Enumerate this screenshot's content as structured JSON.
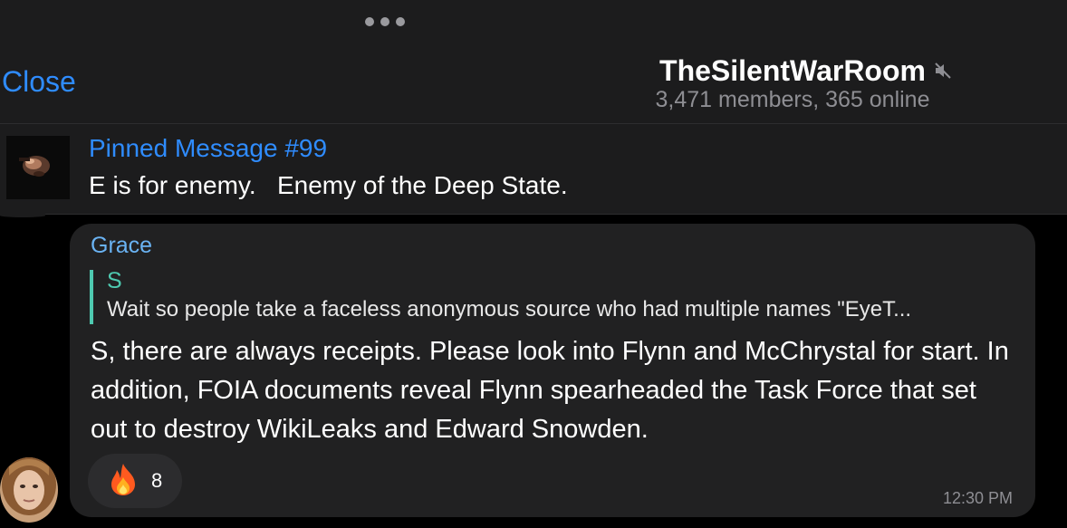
{
  "header": {
    "close_label": "Close",
    "title": "TheSilentWarRoom",
    "subtitle": "3,471 members, 365 online",
    "muted_icon": "speaker-muted-icon"
  },
  "pinned": {
    "title": "Pinned Message #99",
    "text": "E is for enemy.   Enemy of the Deep State."
  },
  "message": {
    "sender": "Grace",
    "reply": {
      "name": "S",
      "text": "Wait so people take a faceless anonymous source who had multiple names \"EyeT..."
    },
    "text": "S, there are always receipts. Please look into Flynn and McChrystal for start. In addition, FOIA documents reveal Flynn spearheaded the Task Force that set out to destroy WikiLeaks and Edward Snowden.",
    "reaction": {
      "emoji": "fire-emoji",
      "count": "8"
    },
    "time": "12:30 PM"
  },
  "colors": {
    "accent": "#2f8cff",
    "sender": "#6ab3f3",
    "reply_bar": "#4ec9b0",
    "bubble": "#212122",
    "header_bg": "#1c1c1d"
  }
}
